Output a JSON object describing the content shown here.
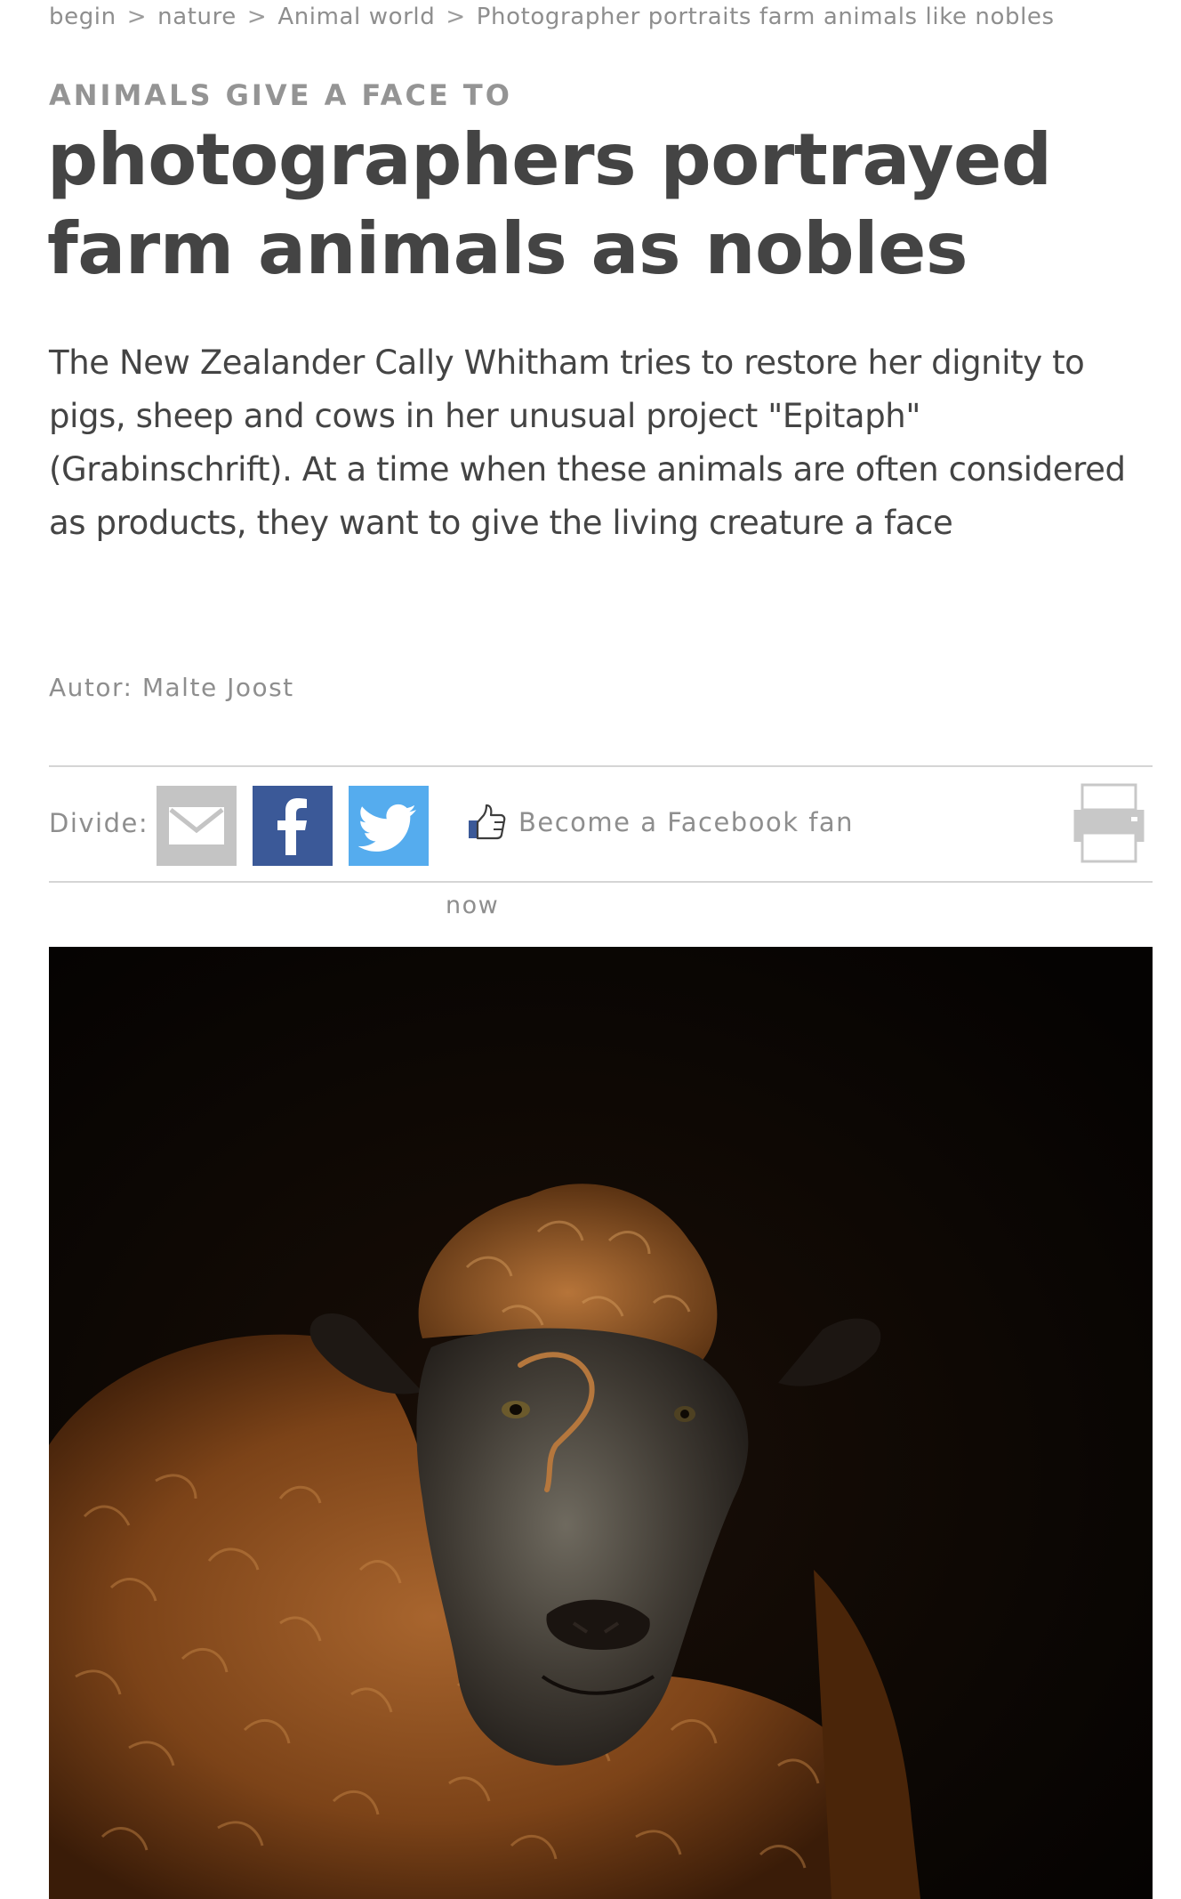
{
  "breadcrumb": {
    "items": [
      "begin",
      "nature",
      "Animal world",
      "Photographer portraits farm animals like nobles"
    ],
    "separator": ">"
  },
  "article": {
    "kicker": "ANIMALS GIVE A FACE TO",
    "title": "photographers portrayed farm animals as nobles",
    "lead": "The New Zealander Cally Whitham tries to restore her dignity to pigs, sheep and cows in her unusual project \"Epitaph\" (Grabinschrift). At a time when these animals are often considered as products, they want to give the living creature a face",
    "author": "Autor: Malte Joost"
  },
  "share": {
    "label": "Divide:",
    "buttons": [
      {
        "icon": "mail-icon",
        "color": "#c4c4c4"
      },
      {
        "icon": "facebook-icon",
        "color": "#3b5998"
      },
      {
        "icon": "twitter-icon",
        "color": "#55acee"
      }
    ],
    "fan_icon": "thumbs-up-icon",
    "fan_label": "Become a Facebook fan",
    "print_icon": "printer-icon",
    "now_label": "now"
  },
  "image": {
    "subject": "sheep-portrait",
    "background_color": "#080503",
    "wool_color": "#8a4e22"
  }
}
